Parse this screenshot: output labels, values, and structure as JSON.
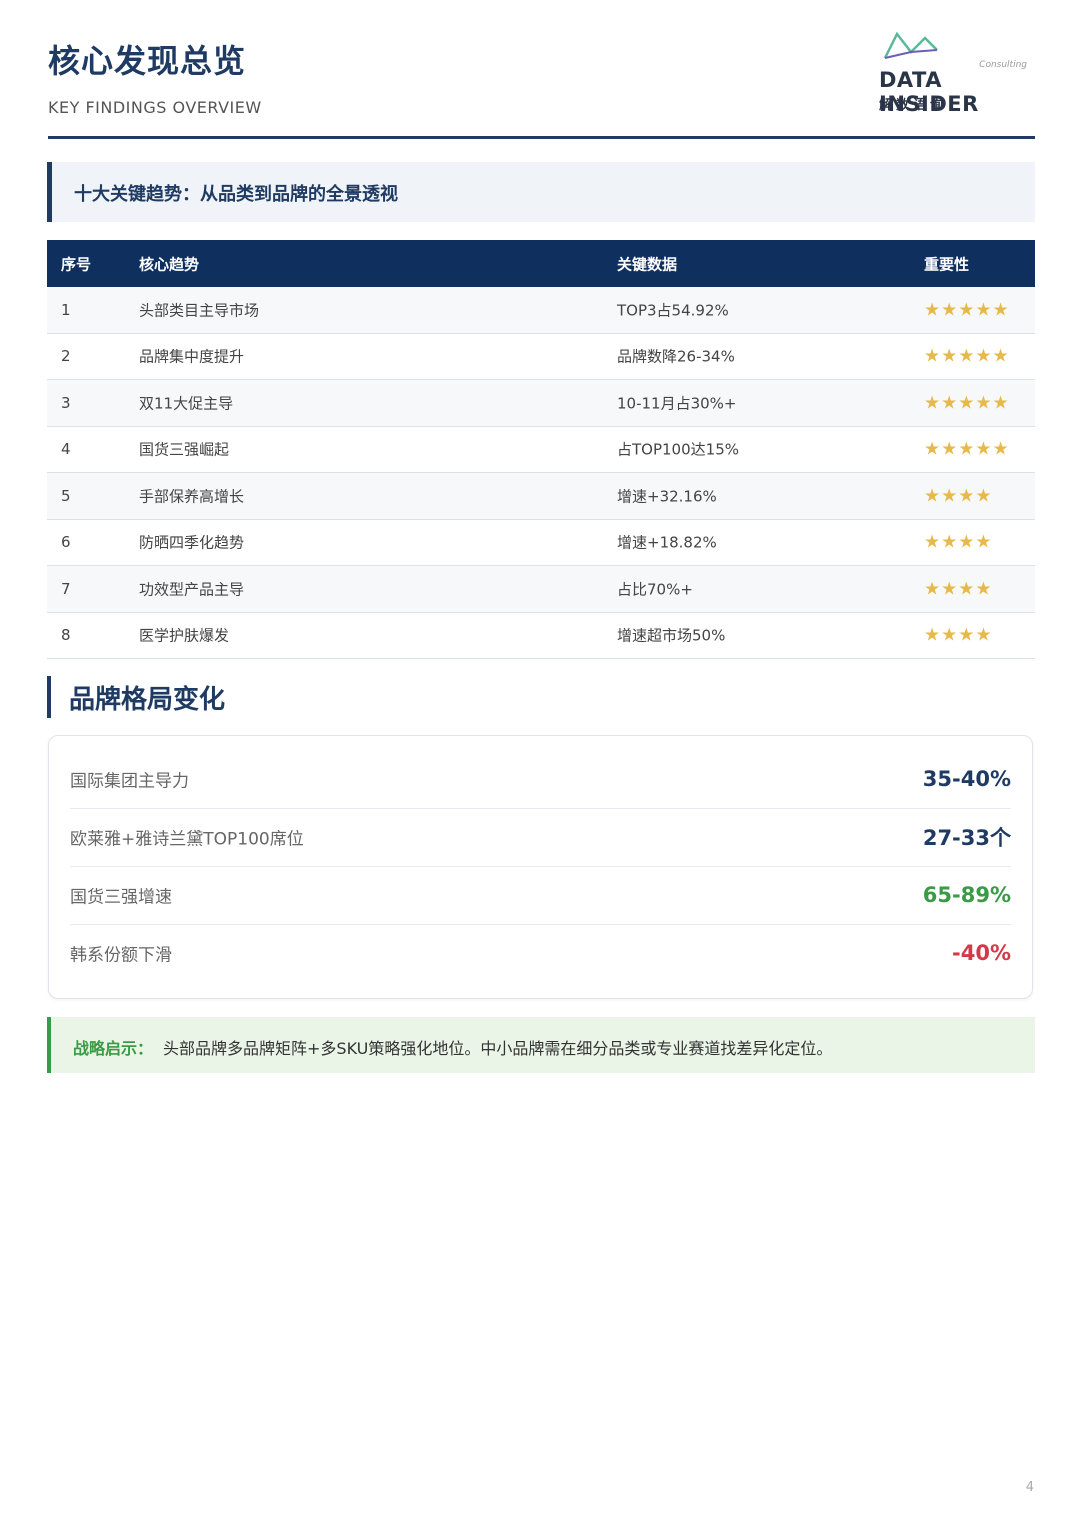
{
  "header": {
    "title": "核心发现总览",
    "subtitle": "KEY FINDINGS OVERVIEW",
    "logo": {
      "consulting": "Consulting",
      "brand": "DATA INSIDER",
      "brand_cn": "解数语询"
    }
  },
  "banner": {
    "text": "十大关键趋势：从品类到品牌的全景透视"
  },
  "trends_table": {
    "headers": [
      "序号",
      "核心趋势",
      "关键数据",
      "重要性"
    ],
    "rows": [
      {
        "no": "1",
        "trend": "头部类目主导市场",
        "data": "TOP3占54.92%",
        "stars": "★★★★★",
        "rating": 5
      },
      {
        "no": "2",
        "trend": "品牌集中度提升",
        "data": "品牌数降26-34%",
        "stars": "★★★★★",
        "rating": 5
      },
      {
        "no": "3",
        "trend": "双11大促主导",
        "data": "10-11月占30%+",
        "stars": "★★★★★",
        "rating": 5
      },
      {
        "no": "4",
        "trend": "国货三强崛起",
        "data": "占TOP100达15%",
        "stars": "★★★★★",
        "rating": 5
      },
      {
        "no": "5",
        "trend": "手部保养高增长",
        "data": "增速+32.16%",
        "stars": "★★★★",
        "rating": 4
      },
      {
        "no": "6",
        "trend": "防晒四季化趋势",
        "data": "增速+18.82%",
        "stars": "★★★★",
        "rating": 4
      },
      {
        "no": "7",
        "trend": "功效型产品主导",
        "data": "占比70%+",
        "stars": "★★★★",
        "rating": 4
      },
      {
        "no": "8",
        "trend": "医学护肤爆发",
        "data": "增速超市场50%",
        "stars": "★★★★",
        "rating": 4
      }
    ]
  },
  "brand_section": {
    "title": "品牌格局变化",
    "items": [
      {
        "label": "国际集团主导力",
        "value": "35-40%",
        "color": "#1f3b63"
      },
      {
        "label": "欧莱雅+雅诗兰黛TOP100席位",
        "value": "27-33个",
        "color": "#1f3b63"
      },
      {
        "label": "国货三强增速",
        "value": "65-89%",
        "color": "#3a9a45"
      },
      {
        "label": "韩系份额下滑",
        "value": "-40%",
        "color": "#d23a4a"
      }
    ]
  },
  "tip": {
    "label": "战略启示：",
    "text": "头部品牌多品牌矩阵+多SKU策略强化地位。中小品牌需在细分品类或专业赛道找差异化定位。"
  },
  "page_number": "4"
}
